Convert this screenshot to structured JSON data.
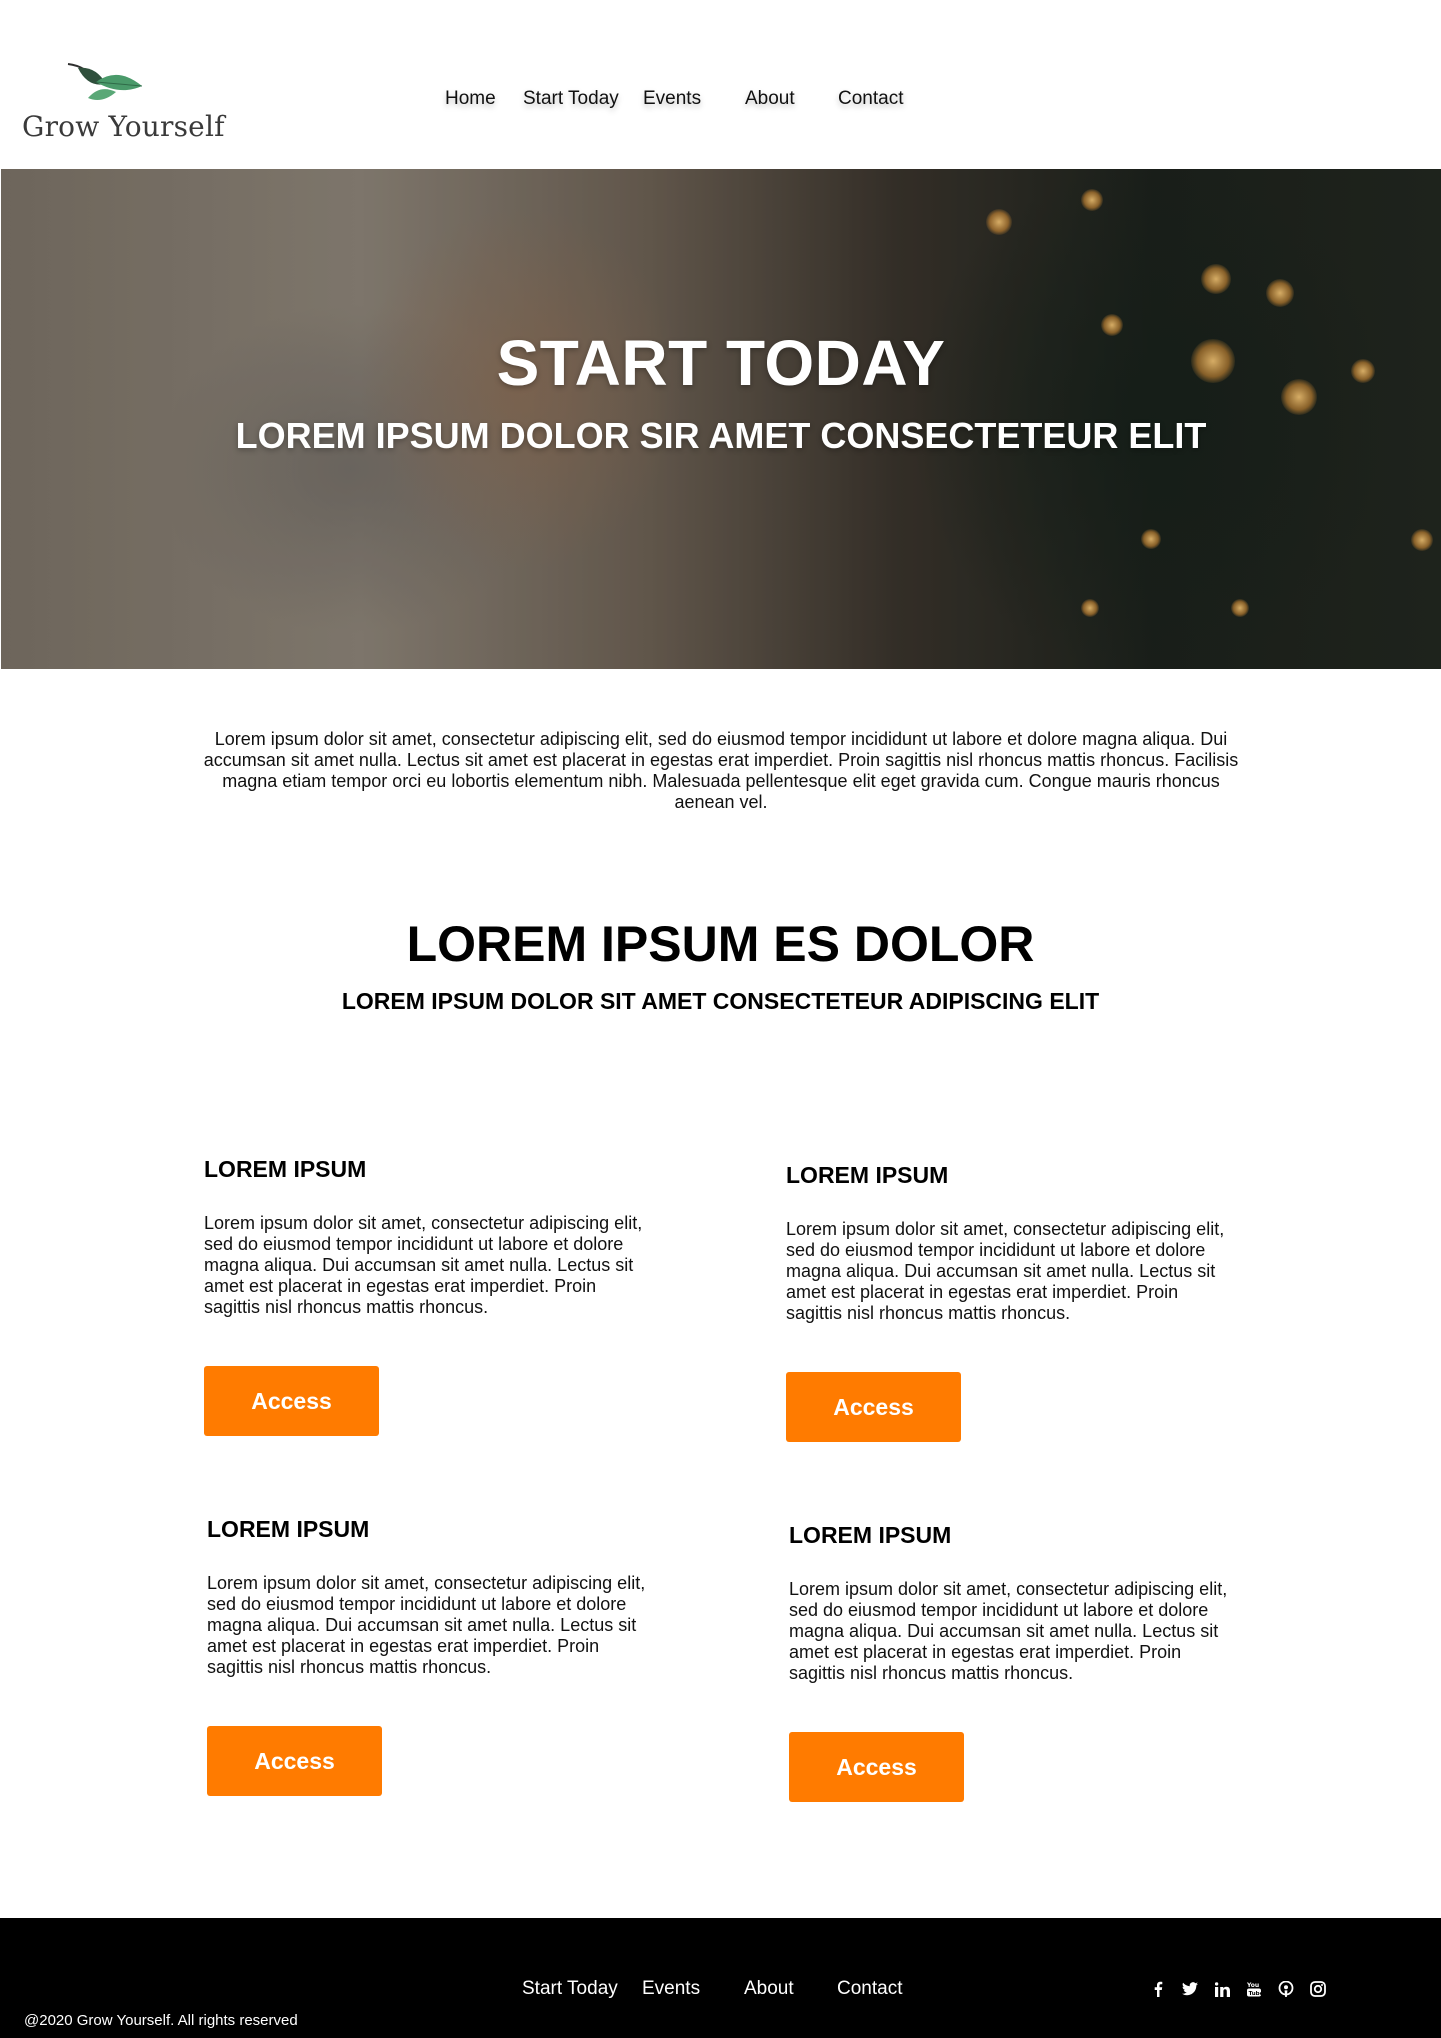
{
  "brand": {
    "name": "Grow Yourself",
    "accent": "#ff7b00",
    "leaf_color": "#3f8a5c"
  },
  "nav": {
    "items": [
      {
        "label": "Home"
      },
      {
        "label": "Start Today"
      },
      {
        "label": "Events"
      },
      {
        "label": "About"
      },
      {
        "label": "Contact"
      }
    ]
  },
  "hero": {
    "title": "START TODAY",
    "subtitle": "LOREM IPSUM DOLOR SIR AMET CONSECTETEUR ELIT"
  },
  "intro": {
    "text": "Lorem ipsum dolor sit amet, consectetur adipiscing elit, sed do eiusmod tempor incididunt ut labore et dolore magna aliqua. Dui accumsan sit amet nulla. Lectus sit amet est placerat in egestas erat imperdiet. Proin sagittis nisl rhoncus mattis rhoncus. Facilisis magna etiam tempor orci eu lobortis elementum nibh. Malesuada pellentesque elit eget gravida cum. Congue mauris rhoncus aenean vel."
  },
  "section": {
    "title": "LOREM IPSUM ES DOLOR",
    "subtitle": "LOREM IPSUM DOLOR SIT AMET CONSECTETEUR ADIPISCING ELIT"
  },
  "cards": [
    {
      "title": "LOREM IPSUM",
      "text": "Lorem ipsum dolor sit amet, consectetur adipiscing elit, sed do eiusmod tempor incididunt ut labore et dolore magna aliqua. Dui accumsan sit amet nulla. Lectus sit amet est placerat in egestas erat imperdiet. Proin sagittis nisl rhoncus mattis rhoncus.",
      "button": "Access"
    },
    {
      "title": "LOREM IPSUM",
      "text": "Lorem ipsum dolor sit amet, consectetur adipiscing elit, sed do eiusmod tempor incididunt ut labore et dolore magna aliqua. Dui accumsan sit amet nulla. Lectus sit amet est placerat in egestas erat imperdiet. Proin sagittis nisl rhoncus mattis rhoncus.",
      "button": "Access"
    },
    {
      "title": "LOREM IPSUM",
      "text": "Lorem ipsum dolor sit amet, consectetur adipiscing elit, sed do eiusmod tempor incididunt ut labore et dolore magna aliqua. Dui accumsan sit amet nulla. Lectus sit amet est placerat in egestas erat imperdiet. Proin sagittis nisl rhoncus mattis rhoncus.",
      "button": "Access"
    },
    {
      "title": "LOREM IPSUM",
      "text": "Lorem ipsum dolor sit amet, consectetur adipiscing elit, sed do eiusmod tempor incididunt ut labore et dolore magna aliqua. Dui accumsan sit amet nulla. Lectus sit amet est placerat in egestas erat imperdiet. Proin sagittis nisl rhoncus mattis rhoncus.",
      "button": "Access"
    }
  ],
  "footer": {
    "nav": [
      {
        "label": "Start Today"
      },
      {
        "label": "Events"
      },
      {
        "label": "About"
      },
      {
        "label": "Contact"
      }
    ],
    "copyright": "@2020 Grow Yourself. All rights reserved",
    "social": [
      "facebook-icon",
      "twitter-icon",
      "linkedin-icon",
      "youtube-icon",
      "podcast-icon",
      "instagram-icon"
    ]
  }
}
